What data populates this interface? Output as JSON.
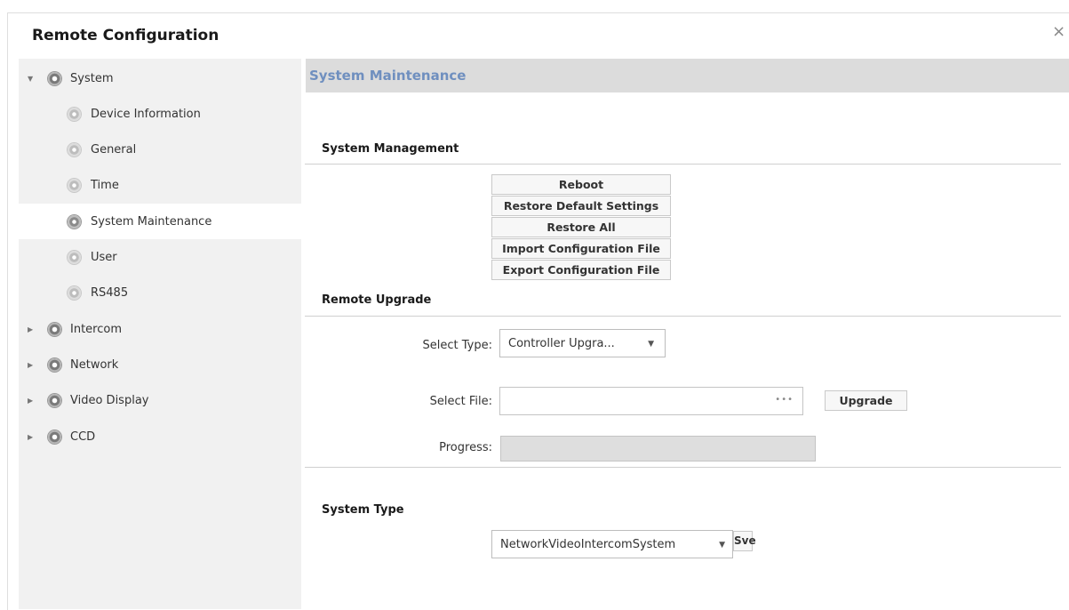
{
  "window": {
    "title": "Remote Configuration",
    "close_glyph": "×"
  },
  "sidebar": {
    "items": [
      {
        "label": "System",
        "level": 0,
        "expanded": true,
        "icon": "gear-icon"
      },
      {
        "label": "Device Information",
        "level": 1,
        "icon": "gear-icon"
      },
      {
        "label": "General",
        "level": 1,
        "icon": "gear-icon"
      },
      {
        "label": "Time",
        "level": 1,
        "icon": "gear-icon"
      },
      {
        "label": "System Maintenance",
        "level": 1,
        "active": true,
        "icon": "gear-icon"
      },
      {
        "label": "User",
        "level": 1,
        "icon": "gear-icon"
      },
      {
        "label": "RS485",
        "level": 1,
        "icon": "gear-icon"
      },
      {
        "label": "Intercom",
        "level": 0,
        "expanded": false,
        "icon": "gear-icon"
      },
      {
        "label": "Network",
        "level": 0,
        "expanded": false,
        "icon": "gear-icon"
      },
      {
        "label": "Video Display",
        "level": 0,
        "expanded": false,
        "icon": "gear-icon"
      },
      {
        "label": "CCD",
        "level": 0,
        "expanded": false,
        "icon": "gear-icon"
      }
    ]
  },
  "main": {
    "header": "System Maintenance",
    "system_management": {
      "title": "System Management",
      "buttons": [
        "Reboot",
        "Restore Default Settings",
        "Restore All",
        "Import Configuration File",
        "Export Configuration File"
      ]
    },
    "remote_upgrade": {
      "title": "Remote Upgrade",
      "type_label": "Select Type:",
      "type_value": "Controller Upgra...",
      "file_label": "Select File:",
      "file_value": "",
      "browse_glyph": "•••",
      "upgrade_label": "Upgrade",
      "progress_label": "Progress:",
      "progress": 0
    },
    "system_type": {
      "title": "System Type",
      "value": "NetworkVideoIntercomSystem",
      "save_label": "Sve"
    }
  },
  "colors": {
    "header_text": "#6f8fbf",
    "header_bg": "#dcdcdc",
    "sidebar_bg": "#f1f1f1"
  }
}
